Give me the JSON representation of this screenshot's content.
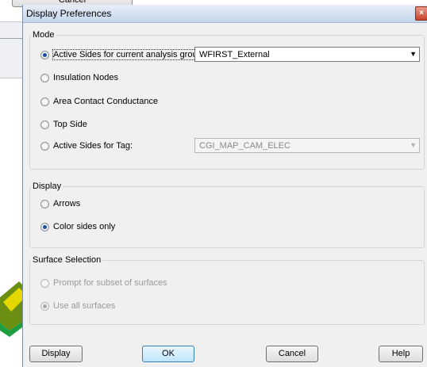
{
  "background": {
    "cancel_label": "Cancel"
  },
  "dialog": {
    "title": "Display Preferences",
    "close_glyph": "×"
  },
  "mode": {
    "label": "Mode",
    "options": [
      {
        "label": "Active Sides for current analysis group:",
        "checked": true,
        "enabled": true
      },
      {
        "label": "Insulation Nodes",
        "checked": false,
        "enabled": true
      },
      {
        "label": "Area Contact Conductance",
        "checked": false,
        "enabled": true
      },
      {
        "label": "Top Side",
        "checked": false,
        "enabled": true
      },
      {
        "label": "Active Sides for Tag:",
        "checked": false,
        "enabled": true
      }
    ],
    "analysis_group_value": "WFIRST_External",
    "tag_value": "CGI_MAP_CAM_ELEC"
  },
  "display": {
    "label": "Display",
    "options": [
      {
        "label": "Arrows",
        "checked": false,
        "enabled": true
      },
      {
        "label": "Color sides only",
        "checked": true,
        "enabled": true
      }
    ]
  },
  "surface_selection": {
    "label": "Surface Selection",
    "options": [
      {
        "label": "Prompt for subset of surfaces",
        "checked": false,
        "enabled": false
      },
      {
        "label": "Use all surfaces",
        "checked": true,
        "enabled": false
      }
    ]
  },
  "buttons": {
    "display": "Display",
    "ok": "OK",
    "cancel": "Cancel",
    "help": "Help"
  },
  "icons": {
    "close": "close-icon",
    "dropdown": "chevron-down-icon"
  },
  "colors": {
    "title_bar": "#c5d6ec",
    "close_button": "#c4442c",
    "dialog_bg": "#f0f0f0",
    "radio_dot": "#1f4f9c"
  }
}
